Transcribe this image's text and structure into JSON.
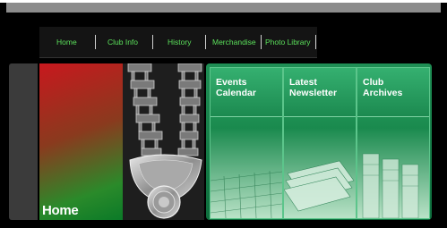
{
  "nav": {
    "items": [
      {
        "label": "Home"
      },
      {
        "label": "Club Info"
      },
      {
        "label": "History"
      },
      {
        "label": "Merchandise"
      },
      {
        "label": "Photo Library"
      }
    ]
  },
  "home_panel": {
    "title": "Home"
  },
  "tiles": [
    {
      "line1": "Events",
      "line2": "Calendar",
      "icon": "calendar-image"
    },
    {
      "line1": "Latest",
      "line2": "Newsletter",
      "icon": "newsletter-stack-image"
    },
    {
      "line1": "Club",
      "line2": "Archives",
      "icon": "archive-files-image"
    }
  ],
  "colors": {
    "nav_text": "#5be05b",
    "panel_green": "#1a8a4e",
    "home_red": "#c8181e"
  }
}
